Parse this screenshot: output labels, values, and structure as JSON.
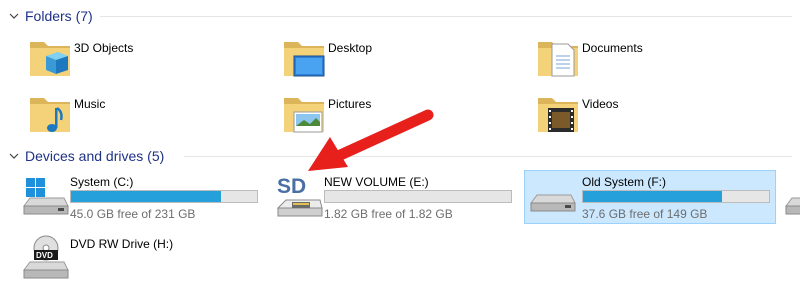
{
  "folders_section": {
    "title": "Folders (7)"
  },
  "folders": [
    {
      "name": "3D Objects",
      "icon": "3d-objects-folder-icon"
    },
    {
      "name": "Desktop",
      "icon": "desktop-folder-icon"
    },
    {
      "name": "Documents",
      "icon": "documents-folder-icon"
    },
    {
      "name": "Music",
      "icon": "music-folder-icon"
    },
    {
      "name": "Pictures",
      "icon": "pictures-folder-icon"
    },
    {
      "name": "Videos",
      "icon": "videos-folder-icon"
    }
  ],
  "devices_section": {
    "title": "Devices and drives (5)"
  },
  "drives": [
    {
      "name": "System (C:)",
      "free_text": "45.0 GB free of 231 GB",
      "used_fraction": 0.805,
      "icon": "windows-drive-icon",
      "selected": false
    },
    {
      "name": "NEW VOLUME (E:)",
      "free_text": "1.82 GB free of 1.82 GB",
      "used_fraction": 0.0,
      "icon": "sd-card-icon",
      "selected": false
    },
    {
      "name": "Old System (F:)",
      "free_text": "37.6 GB free of 149 GB",
      "used_fraction": 0.748,
      "icon": "hard-drive-icon",
      "selected": true
    },
    {
      "name": "DVD RW Drive (H:)",
      "icon": "dvd-drive-icon",
      "selected": false
    }
  ],
  "colors": {
    "accent": "#26a0da",
    "header": "#1e3287",
    "selection": "#cce8ff",
    "annotation_arrow": "#e8201c"
  }
}
